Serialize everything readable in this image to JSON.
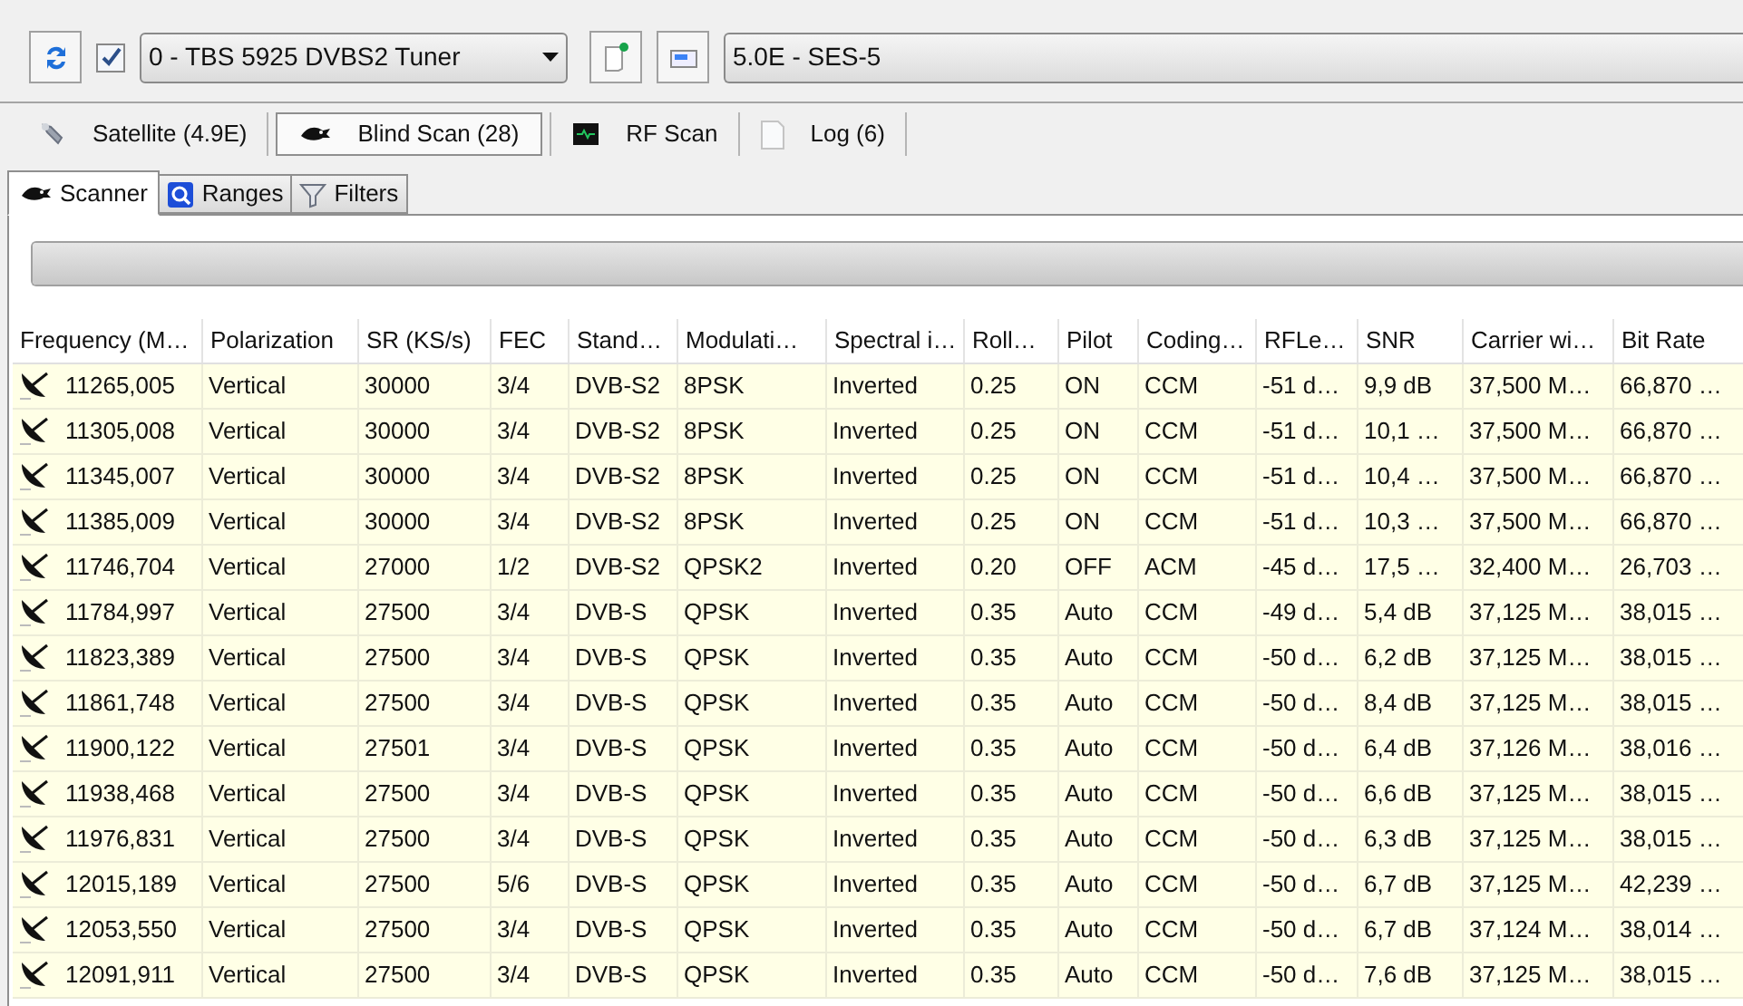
{
  "toolbar": {
    "enabled_checkbox": {
      "checked": true
    },
    "tuner": {
      "value": "0 - TBS 5925 DVBS2 Tuner"
    },
    "satellite": {
      "value": "5.0E - SES-5"
    }
  },
  "main_tabs": [
    {
      "label": "Satellite (4.9E)",
      "kind": "satellite",
      "selected": false
    },
    {
      "label": "Blind Scan (28)",
      "kind": "scan",
      "selected": true
    },
    {
      "label": "RF Scan",
      "kind": "rf",
      "selected": false
    },
    {
      "label": "Log (6)",
      "kind": "log",
      "selected": false
    }
  ],
  "sub_tabs": [
    {
      "label": "Scanner",
      "kind": "scan",
      "selected": true
    },
    {
      "label": "Ranges",
      "kind": "ranges",
      "selected": false
    },
    {
      "label": "Filters",
      "kind": "filters",
      "selected": false
    }
  ],
  "progress": {
    "level": 1
  },
  "table": {
    "columns": [
      "Frequency (M…",
      "Polarization",
      "SR (KS/s)",
      "FEC",
      "Stand…",
      "Modulati…",
      "Spectral i…",
      "Roll…",
      "Pilot",
      "Coding…",
      "RFLe…",
      "SNR",
      "Carrier wi…",
      "Bit Rate"
    ],
    "rows": [
      [
        "11265,005",
        "Vertical",
        "30000",
        "3/4",
        "DVB-S2",
        "8PSK",
        "Inverted",
        "0.25",
        "ON",
        "CCM",
        "-51 d…",
        "9,9 dB",
        "37,500 M…",
        "66,870 …"
      ],
      [
        "11305,008",
        "Vertical",
        "30000",
        "3/4",
        "DVB-S2",
        "8PSK",
        "Inverted",
        "0.25",
        "ON",
        "CCM",
        "-51 d…",
        "10,1 …",
        "37,500 M…",
        "66,870 …"
      ],
      [
        "11345,007",
        "Vertical",
        "30000",
        "3/4",
        "DVB-S2",
        "8PSK",
        "Inverted",
        "0.25",
        "ON",
        "CCM",
        "-51 d…",
        "10,4 …",
        "37,500 M…",
        "66,870 …"
      ],
      [
        "11385,009",
        "Vertical",
        "30000",
        "3/4",
        "DVB-S2",
        "8PSK",
        "Inverted",
        "0.25",
        "ON",
        "CCM",
        "-51 d…",
        "10,3 …",
        "37,500 M…",
        "66,870 …"
      ],
      [
        "11746,704",
        "Vertical",
        "27000",
        "1/2",
        "DVB-S2",
        "QPSK2",
        "Inverted",
        "0.20",
        "OFF",
        "ACM",
        "-45 d…",
        "17,5 …",
        "32,400 M…",
        "26,703 …"
      ],
      [
        "11784,997",
        "Vertical",
        "27500",
        "3/4",
        "DVB-S",
        "QPSK",
        "Inverted",
        "0.35",
        "Auto",
        "CCM",
        "-49 d…",
        "5,4 dB",
        "37,125 M…",
        "38,015 …"
      ],
      [
        "11823,389",
        "Vertical",
        "27500",
        "3/4",
        "DVB-S",
        "QPSK",
        "Inverted",
        "0.35",
        "Auto",
        "CCM",
        "-50 d…",
        "6,2 dB",
        "37,125 M…",
        "38,015 …"
      ],
      [
        "11861,748",
        "Vertical",
        "27500",
        "3/4",
        "DVB-S",
        "QPSK",
        "Inverted",
        "0.35",
        "Auto",
        "CCM",
        "-50 d…",
        "8,4 dB",
        "37,125 M…",
        "38,015 …"
      ],
      [
        "11900,122",
        "Vertical",
        "27501",
        "3/4",
        "DVB-S",
        "QPSK",
        "Inverted",
        "0.35",
        "Auto",
        "CCM",
        "-50 d…",
        "6,4 dB",
        "37,126 M…",
        "38,016 …"
      ],
      [
        "11938,468",
        "Vertical",
        "27500",
        "3/4",
        "DVB-S",
        "QPSK",
        "Inverted",
        "0.35",
        "Auto",
        "CCM",
        "-50 d…",
        "6,6 dB",
        "37,125 M…",
        "38,015 …"
      ],
      [
        "11976,831",
        "Vertical",
        "27500",
        "3/4",
        "DVB-S",
        "QPSK",
        "Inverted",
        "0.35",
        "Auto",
        "CCM",
        "-50 d…",
        "6,3 dB",
        "37,125 M…",
        "38,015 …"
      ],
      [
        "12015,189",
        "Vertical",
        "27500",
        "5/6",
        "DVB-S",
        "QPSK",
        "Inverted",
        "0.35",
        "Auto",
        "CCM",
        "-50 d…",
        "6,7 dB",
        "37,125 M…",
        "42,239 …"
      ],
      [
        "12053,550",
        "Vertical",
        "27500",
        "3/4",
        "DVB-S",
        "QPSK",
        "Inverted",
        "0.35",
        "Auto",
        "CCM",
        "-50 d…",
        "6,7 dB",
        "37,124 M…",
        "38,014 …"
      ],
      [
        "12091,911",
        "Vertical",
        "27500",
        "3/4",
        "DVB-S",
        "QPSK",
        "Inverted",
        "0.35",
        "Auto",
        "CCM",
        "-50 d…",
        "7,6 dB",
        "37,125 M…",
        "38,015 …"
      ]
    ]
  }
}
